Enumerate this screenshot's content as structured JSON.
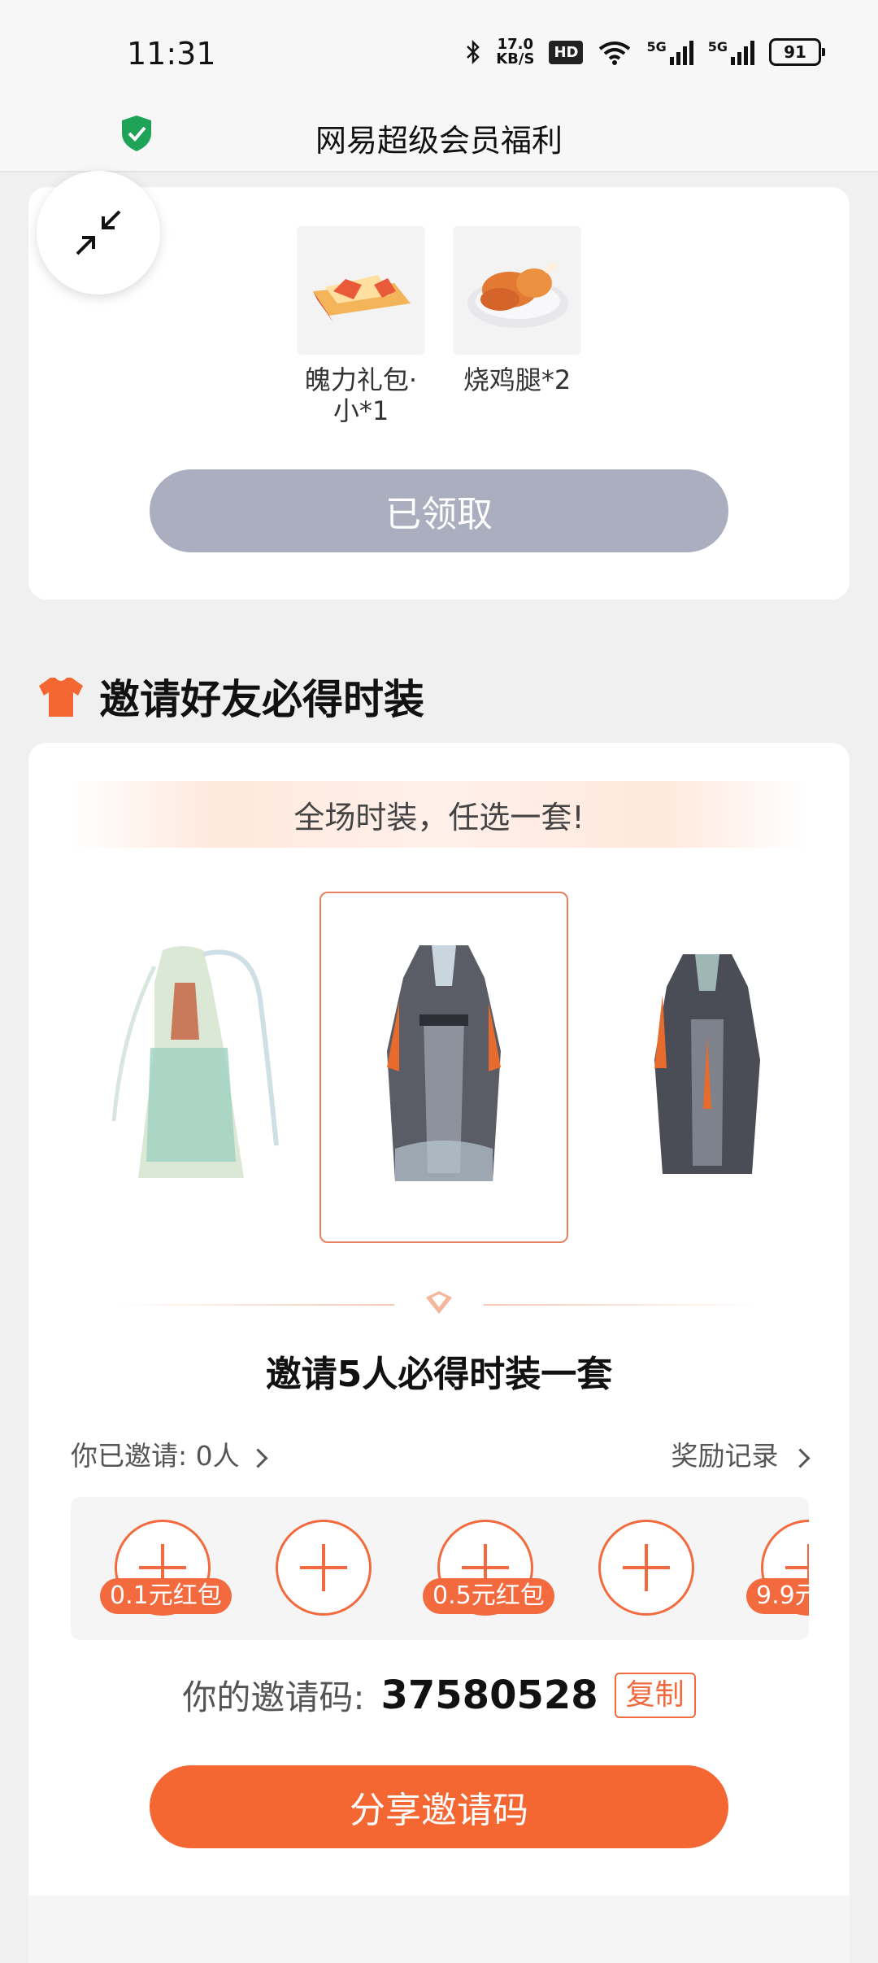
{
  "status_bar": {
    "time": "11:31",
    "net_speed_value": "17.0",
    "net_speed_unit": "KB/S",
    "hd_label": "HD",
    "signal_1": "5G",
    "signal_2": "5G",
    "battery": "91"
  },
  "header": {
    "title": "网易超级会员福利"
  },
  "rewards": {
    "items": [
      {
        "name": "魄力礼包·小*1"
      },
      {
        "name": "烧鸡腿*2"
      }
    ],
    "claimed_label": "已领取"
  },
  "invite_section": {
    "title": "邀请好友必得时装",
    "banner": "全场时装，任选一套!",
    "invite_title": "邀请5人必得时装一套",
    "invited_label": "你已邀请:",
    "invited_count": "0人",
    "reward_record": "奖励记录",
    "slots": [
      {
        "badge": "0.1元红包"
      },
      {
        "badge": ""
      },
      {
        "badge": "0.5元红包"
      },
      {
        "badge": ""
      },
      {
        "badge": "9.9元"
      }
    ],
    "code_label": "你的邀请码:",
    "code_value": "37580528",
    "copy_label": "复制",
    "share_label": "分享邀请码"
  },
  "colors": {
    "accent": "#f46733",
    "claimed": "#abaebf",
    "shield": "#1ea359"
  }
}
